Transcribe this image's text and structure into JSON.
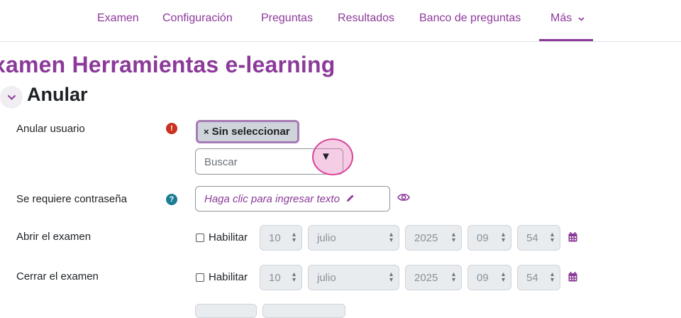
{
  "nav": {
    "items": [
      "Examen",
      "Configuración",
      "Preguntas",
      "Resultados",
      "Banco de preguntas",
      "Más"
    ],
    "active": "Más"
  },
  "page_title": "xamen Herramientas e-learning",
  "section": {
    "title": "Anular"
  },
  "form": {
    "user_label": "Anular usuario",
    "chip_label": "Sin seleccionar",
    "chip_remove": "×",
    "search_placeholder": "Buscar",
    "search_arrow": "▼",
    "password_label": "Se requiere contraseña",
    "password_placeholder": "Haga clic para ingresar texto",
    "open_label": "Abrir el examen",
    "close_label": "Cerrar el examen",
    "enable_label": "Habilitar",
    "open_date": {
      "day": "10",
      "month": "julio",
      "year": "2025",
      "hour": "09",
      "minute": "54"
    },
    "close_date": {
      "day": "10",
      "month": "julio",
      "year": "2025",
      "hour": "09",
      "minute": "54"
    }
  },
  "colors": {
    "accent": "#8c3a9a",
    "error": "#ca3120",
    "help": "#1b7c93",
    "highlight": "#d9479a"
  },
  "icons": [
    "chevron-down-icon",
    "error-icon",
    "help-icon",
    "pencil-icon",
    "eye-icon",
    "calendar-icon"
  ]
}
